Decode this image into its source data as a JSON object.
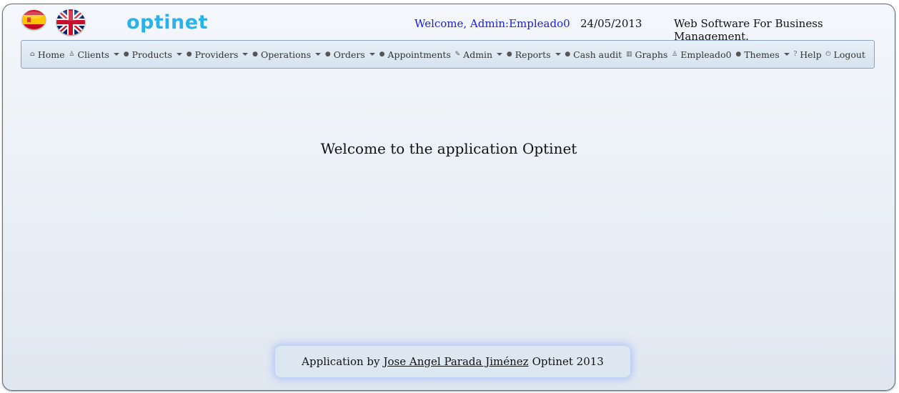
{
  "header": {
    "logo_text": "optinet",
    "welcome": "Welcome, Admin:Empleado0",
    "date": "24/05/2013",
    "tagline": "Web Software For Business Management."
  },
  "flags": [
    "spanish-flag-icon",
    "uk-flag-icon"
  ],
  "nav": [
    {
      "label": "Home",
      "icon": "home-icon",
      "dropdown": false
    },
    {
      "label": "Clients",
      "icon": "user-icon",
      "dropdown": true
    },
    {
      "label": "Products",
      "icon": "bullet-icon",
      "dropdown": true
    },
    {
      "label": "Providers",
      "icon": "bullet-icon",
      "dropdown": true
    },
    {
      "label": "Operations",
      "icon": "bullet-icon",
      "dropdown": true
    },
    {
      "label": "Orders",
      "icon": "bullet-icon",
      "dropdown": true
    },
    {
      "label": "Appointments",
      "icon": "bullet-icon",
      "dropdown": false
    },
    {
      "label": "Admin",
      "icon": "wrench-icon",
      "dropdown": true
    },
    {
      "label": "Reports",
      "icon": "bullet-icon",
      "dropdown": true
    },
    {
      "label": "Cash audit",
      "icon": "bullet-icon",
      "dropdown": false
    },
    {
      "label": "Graphs",
      "icon": "chart-icon",
      "dropdown": false
    },
    {
      "label": "Empleado0",
      "icon": "user-icon",
      "dropdown": false
    },
    {
      "label": "Themes",
      "icon": "bullet-icon",
      "dropdown": true
    },
    {
      "label": "Help",
      "icon": "help-icon",
      "dropdown": false
    },
    {
      "label": "Logout",
      "icon": "power-icon",
      "dropdown": false
    }
  ],
  "main": {
    "title": "Welcome to the application Optinet"
  },
  "footer": {
    "prefix": "Application by",
    "author": "Jose Angel Parada Jiménez",
    "suffix": "Optinet 2013"
  },
  "colors": {
    "logo": "#2ab3e8",
    "welcome": "#1a1ae8",
    "footer_glow": "#8caaff"
  }
}
